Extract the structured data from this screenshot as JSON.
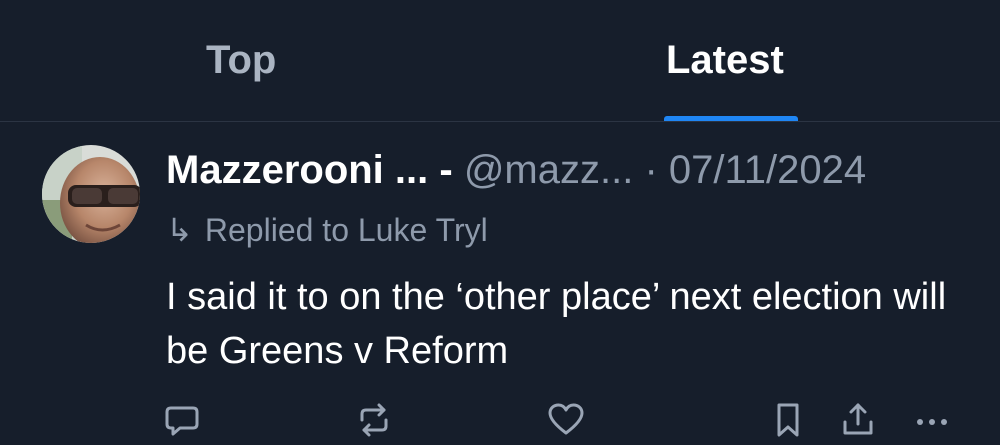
{
  "colors": {
    "background": "#161e2b",
    "accent": "#1f86f4",
    "muted_text": "#8e9aab",
    "divider": "#2b3443"
  },
  "tabs": [
    {
      "label": "Top",
      "selected": false
    },
    {
      "label": "Latest",
      "selected": true
    }
  ],
  "post": {
    "avatar_icon": "profile-photo",
    "display_name": "Mazzerooni ... -",
    "handle": "@mazz...",
    "separator": "·",
    "date": "07/11/2024",
    "reply_arrow": "↳",
    "reply_text": "Replied to Luke Tryl",
    "text": "I said it to on the ‘other place’ next election will be Greens v Reform",
    "actions": [
      {
        "name": "reply",
        "icon": "speech-bubble-icon"
      },
      {
        "name": "repost",
        "icon": "repost-icon"
      },
      {
        "name": "like",
        "icon": "heart-icon"
      },
      {
        "name": "bookmark",
        "icon": "bookmark-icon"
      },
      {
        "name": "share",
        "icon": "share-icon"
      },
      {
        "name": "more",
        "icon": "more-options-icon"
      }
    ]
  }
}
